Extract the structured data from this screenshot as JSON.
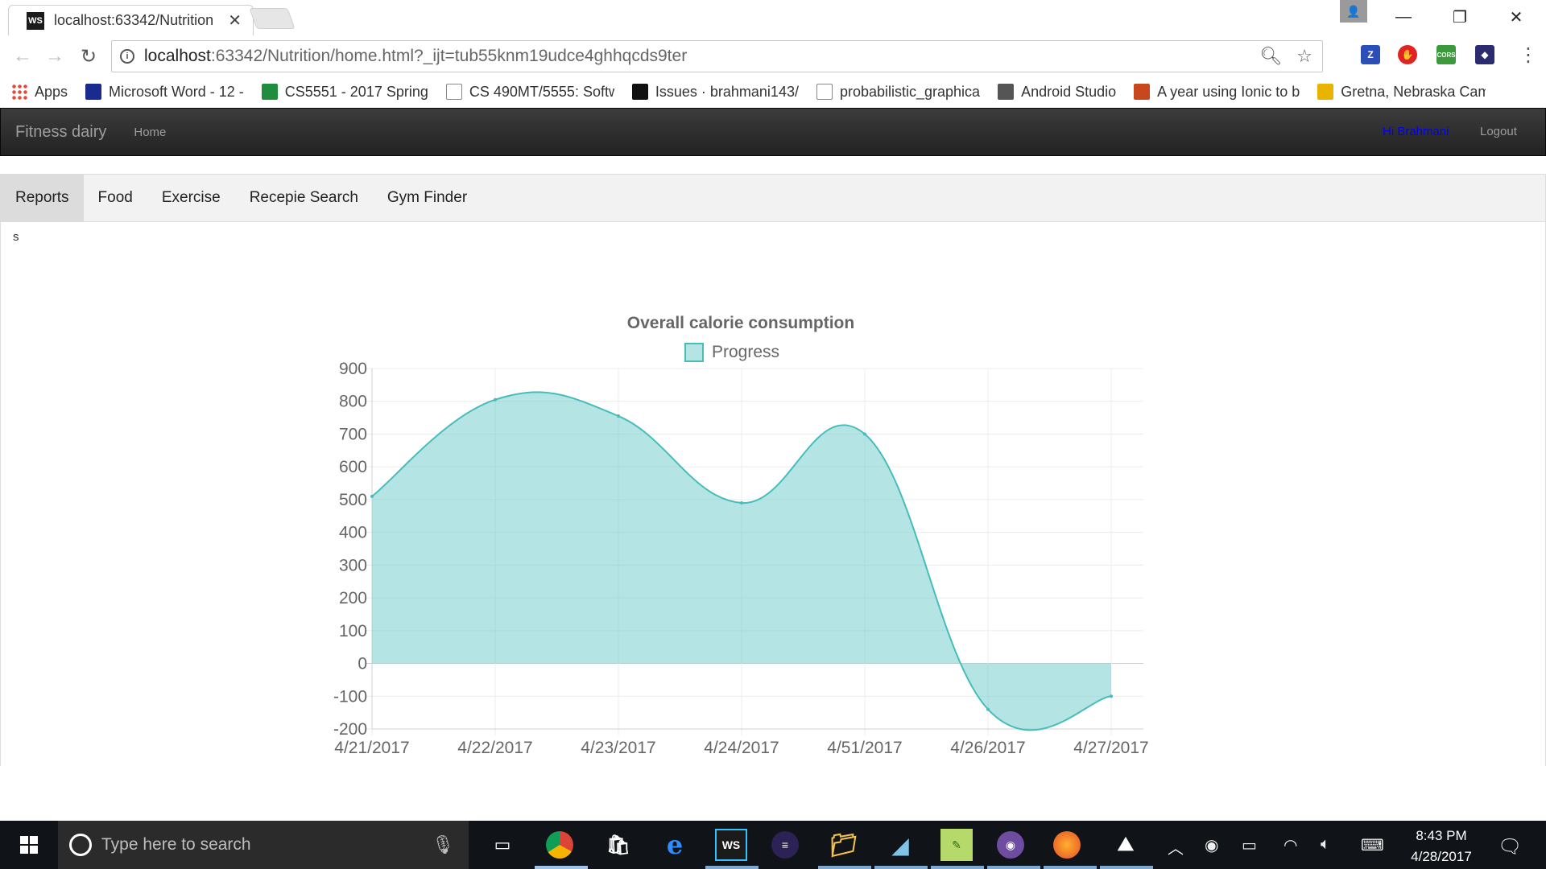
{
  "browser": {
    "tab_title": "localhost:63342/Nutrition",
    "tab_favicon": "WS",
    "url_host": "localhost",
    "url_rest": ":63342/Nutrition/home.html?_ijt=tub55knm19udce4ghhqcds9ter",
    "bookmarks": [
      {
        "label": "Apps",
        "icon": "apps-grid-icon",
        "color": "#e04b3a"
      },
      {
        "label": "Microsoft Word - 12 -",
        "icon": "umkc-icon",
        "color": "#1a2b8f"
      },
      {
        "label": "CS5551 - 2017 Spring",
        "icon": "sheets-icon",
        "color": "#1e8e3e"
      },
      {
        "label": "CS 490MT/5555: Softw",
        "icon": "page-icon",
        "color": "#888888"
      },
      {
        "label": "Issues · brahmani143/",
        "icon": "github-icon",
        "color": "#111111"
      },
      {
        "label": "probabilistic_graphica",
        "icon": "page-icon",
        "color": "#888888"
      },
      {
        "label": "Android Studio",
        "icon": "android-studio-icon",
        "color": "#555555"
      },
      {
        "label": "A year using Ionic to b",
        "icon": "ionic-icon",
        "color": "#c9471d"
      },
      {
        "label": "Gretna, Nebraska Cam",
        "icon": "campground-icon",
        "color": "#e8b400"
      }
    ]
  },
  "app": {
    "brand": "Fitness dairy",
    "home": "Home",
    "user": "Hi Brahmani",
    "logout": "Logout",
    "tabs": [
      {
        "label": "Reports",
        "active": true
      },
      {
        "label": "Food",
        "active": false
      },
      {
        "label": "Exercise",
        "active": false
      },
      {
        "label": "Recepie Search",
        "active": false
      },
      {
        "label": "Gym Finder",
        "active": false
      }
    ],
    "stray_text": "s"
  },
  "chart_data": {
    "type": "area",
    "title": "Overall calorie consumption",
    "categories": [
      "4/21/2017",
      "4/22/2017",
      "4/23/2017",
      "4/24/2017",
      "4/51/2017",
      "4/26/2017",
      "4/27/2017"
    ],
    "series": [
      {
        "name": "Progress",
        "values": [
          510,
          805,
          755,
          490,
          700,
          -140,
          -100
        ],
        "color": "#46bdb8",
        "fill": "rgba(118,206,204,0.55)"
      }
    ],
    "ylim": [
      -200,
      900
    ],
    "yticks": [
      900,
      800,
      700,
      600,
      500,
      400,
      300,
      200,
      100,
      0,
      -100,
      -200
    ],
    "grid": true,
    "legend": "top"
  },
  "taskbar": {
    "search_placeholder": "Type here to search",
    "time": "8:43 PM",
    "date": "4/28/2017"
  }
}
